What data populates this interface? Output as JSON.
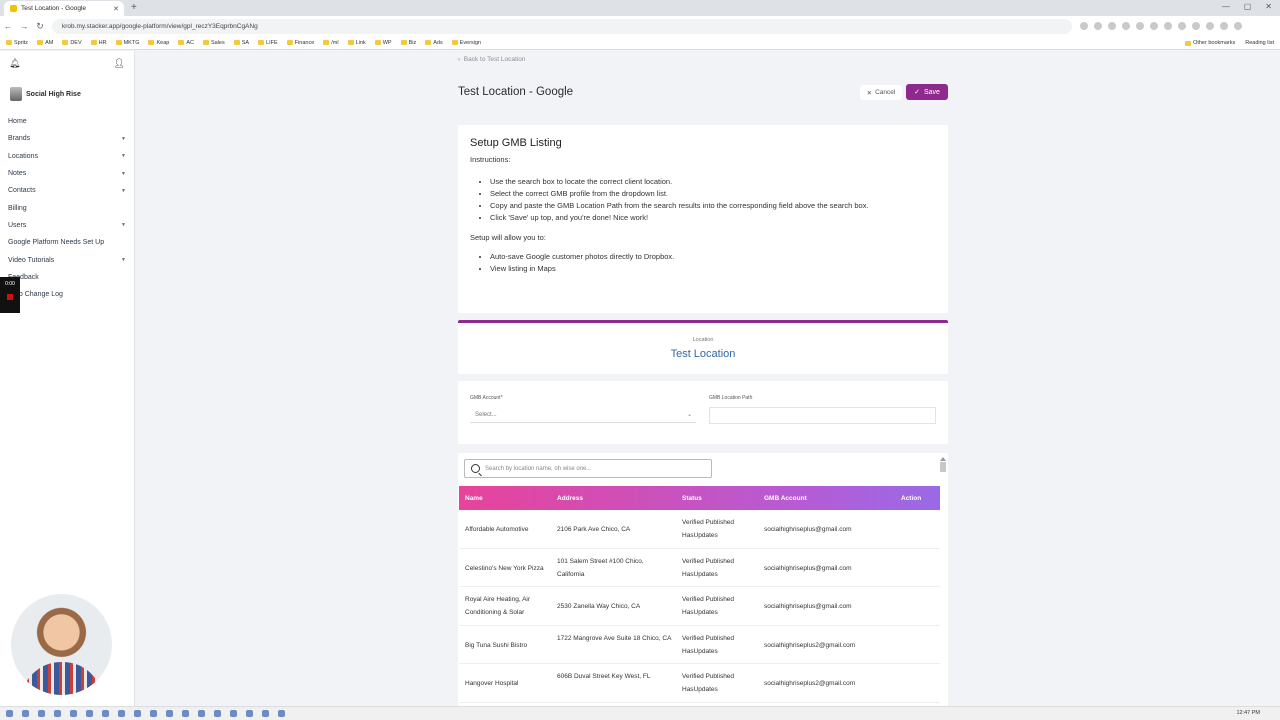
{
  "browser": {
    "tab_title": "Test Location - Google",
    "url": "krob.my.stacker.app/google-platform/view/gpl_reczY3EqprbnCgANg",
    "bookmarks": [
      "Spritz",
      "AM",
      "DEV",
      "HR",
      "MKTG",
      "Keap",
      "AC",
      "Sales",
      "SA",
      "LIFE",
      "Finance",
      "/ml",
      "Link",
      "WP",
      "Biz",
      "Ads",
      "Eversign"
    ],
    "bookmarks_right": [
      "Other bookmarks",
      "Reading list"
    ]
  },
  "sidebar": {
    "brand": "Social High Rise",
    "items": [
      {
        "label": "Home",
        "caret": false
      },
      {
        "label": "Brands",
        "caret": true
      },
      {
        "label": "Locations",
        "caret": true
      },
      {
        "label": "Notes",
        "caret": true
      },
      {
        "label": "Contacts",
        "caret": true
      },
      {
        "label": "Billing",
        "caret": false
      },
      {
        "label": "Users",
        "caret": true
      },
      {
        "label": "Google Platform Needs Set Up",
        "caret": false
      },
      {
        "label": "Video Tutorials",
        "caret": true
      },
      {
        "label": "Feedback",
        "caret": false
      },
      {
        "label": "Krob Change Log",
        "caret": false
      }
    ],
    "recorder_time": "0:00"
  },
  "header": {
    "back_link": "Back to Test Location",
    "title": "Test Location - Google",
    "cancel_label": "Cancel",
    "save_label": "Save"
  },
  "instructions": {
    "heading": "Setup GMB Listing",
    "intro": "Instructions:",
    "steps": [
      "Use the search box to locate the correct client location.",
      "Select the correct GMB profile from the dropdown list.",
      "Copy and paste the GMB Location Path from the search results into the corresponding field above the search box.",
      "Click 'Save' up top, and you're done! Nice work!"
    ],
    "benefits_intro": "Setup will allow you to:",
    "benefits": [
      "Auto-save Google customer photos directly to Dropbox.",
      "View listing in Maps"
    ]
  },
  "location": {
    "label": "Location",
    "value": "Test Location"
  },
  "form": {
    "gmb_account_label": "GMB Account*",
    "gmb_account_value": "Select...",
    "gmb_path_label": "GMB Location Path",
    "gmb_path_value": ""
  },
  "results": {
    "search_placeholder": "Search by location name, oh wise one...",
    "columns": [
      "Name",
      "Address",
      "Status",
      "GMB Account",
      "Action"
    ],
    "rows": [
      {
        "name": "Affordable Automotive",
        "address": "2106 Park Ave Chico, CA",
        "status": "Verified Published HasUpdates",
        "account": "socialhighriseplus@gmail.com"
      },
      {
        "name": "Celestino's New York Pizza",
        "address": "101 Salem Street #100 Chico, California",
        "status": "Verified Published HasUpdates",
        "account": "socialhighriseplus@gmail.com"
      },
      {
        "name": "Royal Aire Heating, Air Conditioning & Solar",
        "address": "2530 Zanella Way Chico, CA",
        "status": "Verified Published HasUpdates",
        "account": "socialhighriseplus@gmail.com"
      },
      {
        "name": "Big Tuna Sushi Bistro",
        "address": "1722 Mangrove Ave Suite 18 Chico, CA",
        "status": "Verified Published HasUpdates",
        "account": "socialhighriseplus2@gmail.com"
      },
      {
        "name": "Hangover Hospital",
        "address": "606B Duval Street Key West, FL",
        "status": "Verified Published HasUpdates",
        "account": "socialhighriseplus2@gmail.com"
      }
    ]
  },
  "taskbar": {
    "time": "12:47 PM"
  }
}
